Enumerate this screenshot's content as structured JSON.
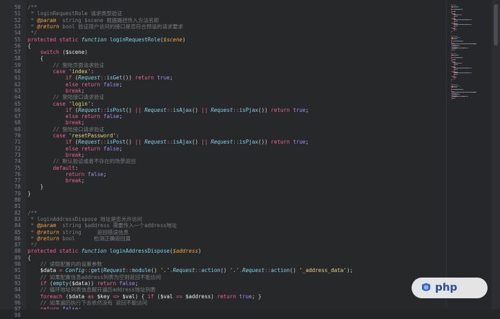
{
  "editor": {
    "first_line": 50,
    "lines": [
      [
        [
          "c",
          "/**"
        ]
      ],
      [
        [
          "c",
          " * loginRequestRole 请求类型验证"
        ]
      ],
      [
        [
          "c",
          " * "
        ],
        [
          "d",
          "@param"
        ],
        [
          "c",
          "  string $scene 根据路径传入方法名称"
        ]
      ],
      [
        [
          "c",
          " * "
        ],
        [
          "d",
          "@return"
        ],
        [
          "c",
          " bool 验证用户访问的接口是否符合预设的请求要求"
        ]
      ],
      [
        [
          "c",
          " */"
        ]
      ],
      [
        [
          "k",
          "protected static "
        ],
        [
          "i",
          "function "
        ],
        [
          "f",
          "loginRequestRole"
        ],
        [
          "p",
          "("
        ],
        [
          "d",
          "$scene"
        ],
        [
          "p",
          ")"
        ]
      ],
      [
        [
          "p",
          "{"
        ]
      ],
      [
        [
          "p",
          "    "
        ],
        [
          "k",
          "switch "
        ],
        [
          "p",
          "("
        ],
        [
          "v",
          "$scene"
        ],
        [
          "p",
          ")"
        ]
      ],
      [
        [
          "p",
          "    {"
        ]
      ],
      [
        [
          "c",
          "        // 登陆页面请求验证"
        ]
      ],
      [
        [
          "p",
          "        "
        ],
        [
          "k",
          "case "
        ],
        [
          "s",
          "'index'"
        ],
        [
          "p",
          ":"
        ]
      ],
      [
        [
          "p",
          "            "
        ],
        [
          "k",
          "if "
        ],
        [
          "p",
          "("
        ],
        [
          "i",
          "Request"
        ],
        [
          "k",
          "::"
        ],
        [
          "f",
          "isGet"
        ],
        [
          "p",
          "()) "
        ],
        [
          "k",
          "return "
        ],
        [
          "n",
          "true"
        ],
        [
          "p",
          ";"
        ]
      ],
      [
        [
          "p",
          "            "
        ],
        [
          "k",
          "else return "
        ],
        [
          "n",
          "false"
        ],
        [
          "p",
          ";"
        ]
      ],
      [
        [
          "p",
          "            "
        ],
        [
          "k",
          "break"
        ],
        [
          "p",
          ";"
        ]
      ],
      [
        [
          "c",
          "        // 登陆接口请求验证"
        ]
      ],
      [
        [
          "p",
          "        "
        ],
        [
          "k",
          "case "
        ],
        [
          "s",
          "'login'"
        ],
        [
          "p",
          ":"
        ]
      ],
      [
        [
          "p",
          "            "
        ],
        [
          "k",
          "if "
        ],
        [
          "p",
          "("
        ],
        [
          "i",
          "Request"
        ],
        [
          "k",
          "::"
        ],
        [
          "f",
          "isPost"
        ],
        [
          "p",
          "() "
        ],
        [
          "k",
          "|| "
        ],
        [
          "i",
          "Request"
        ],
        [
          "k",
          "::"
        ],
        [
          "f",
          "isAjax"
        ],
        [
          "p",
          "() "
        ],
        [
          "k",
          "|| "
        ],
        [
          "i",
          "Request"
        ],
        [
          "k",
          "::"
        ],
        [
          "f",
          "isPjax"
        ],
        [
          "p",
          "()) "
        ],
        [
          "k",
          "return "
        ],
        [
          "n",
          "true"
        ],
        [
          "p",
          ";"
        ]
      ],
      [
        [
          "p",
          "            "
        ],
        [
          "k",
          "else return "
        ],
        [
          "n",
          "false"
        ],
        [
          "p",
          ";"
        ]
      ],
      [
        [
          "p",
          "            "
        ],
        [
          "k",
          "break"
        ],
        [
          "p",
          ";"
        ]
      ],
      [
        [
          "c",
          "        // 登陆接口请求验证"
        ]
      ],
      [
        [
          "p",
          "        "
        ],
        [
          "k",
          "case "
        ],
        [
          "s",
          "'resetPassword'"
        ],
        [
          "p",
          ":"
        ]
      ],
      [
        [
          "p",
          "            "
        ],
        [
          "k",
          "if "
        ],
        [
          "p",
          "("
        ],
        [
          "i",
          "Request"
        ],
        [
          "k",
          "::"
        ],
        [
          "f",
          "isPost"
        ],
        [
          "p",
          "() "
        ],
        [
          "k",
          "|| "
        ],
        [
          "i",
          "Request"
        ],
        [
          "k",
          "::"
        ],
        [
          "f",
          "isAjax"
        ],
        [
          "p",
          "() "
        ],
        [
          "k",
          "|| "
        ],
        [
          "i",
          "Request"
        ],
        [
          "k",
          "::"
        ],
        [
          "f",
          "isPjax"
        ],
        [
          "p",
          "()) "
        ],
        [
          "k",
          "return "
        ],
        [
          "n",
          "true"
        ],
        [
          "p",
          ";"
        ]
      ],
      [
        [
          "p",
          "            "
        ],
        [
          "k",
          "else return "
        ],
        [
          "n",
          "false"
        ],
        [
          "p",
          ";"
        ]
      ],
      [
        [
          "p",
          "            "
        ],
        [
          "k",
          "break"
        ],
        [
          "p",
          ";"
        ]
      ],
      [
        [
          "c",
          "        // 默认验证或者不存在的场景返回"
        ]
      ],
      [
        [
          "p",
          "        "
        ],
        [
          "k",
          "default"
        ],
        [
          "p",
          ":"
        ]
      ],
      [
        [
          "p",
          "            "
        ],
        [
          "k",
          "return "
        ],
        [
          "n",
          "false"
        ],
        [
          "p",
          ";"
        ]
      ],
      [
        [
          "p",
          "            "
        ],
        [
          "k",
          "break"
        ],
        [
          "p",
          ";"
        ]
      ],
      [
        [
          "p",
          "    }"
        ]
      ],
      [
        [
          "p",
          "}"
        ]
      ],
      [],
      [],
      [
        [
          "c",
          "/**"
        ]
      ],
      [
        [
          "c",
          " * loginAddressDispose 地址是否允许访问"
        ]
      ],
      [
        [
          "c",
          " * "
        ],
        [
          "d",
          "@param"
        ],
        [
          "c",
          "  string $address 需要传入一个address地址"
        ]
      ],
      [
        [
          "c",
          " * "
        ],
        [
          "d",
          "@return"
        ],
        [
          "c",
          " string     返回错误信息"
        ]
      ],
      [
        [
          "c",
          " * "
        ],
        [
          "d",
          "@return"
        ],
        [
          "c",
          " bool      检测正确返回真"
        ]
      ],
      [
        [
          "c",
          " */"
        ]
      ],
      [
        [
          "k",
          "protected static "
        ],
        [
          "i",
          "function "
        ],
        [
          "f",
          "loginAddressDispose"
        ],
        [
          "p",
          "("
        ],
        [
          "d",
          "$address"
        ],
        [
          "p",
          ")"
        ]
      ],
      [
        [
          "p",
          "{"
        ]
      ],
      [
        [
          "c",
          "    // 读取配置内的设置参数"
        ]
      ],
      [
        [
          "p",
          "    "
        ],
        [
          "v",
          "$data "
        ],
        [
          "k",
          "= "
        ],
        [
          "i",
          "Config"
        ],
        [
          "k",
          "::"
        ],
        [
          "f",
          "get"
        ],
        [
          "p",
          "("
        ],
        [
          "i",
          "Request"
        ],
        [
          "k",
          "::"
        ],
        [
          "f",
          "module"
        ],
        [
          "p",
          "() "
        ],
        [
          "s",
          "'.'"
        ],
        [
          "k",
          "."
        ],
        [
          "i",
          "Request"
        ],
        [
          "k",
          "::"
        ],
        [
          "f",
          "action"
        ],
        [
          "p",
          "() "
        ],
        [
          "s",
          "'.'"
        ],
        [
          "k",
          "."
        ],
        [
          "i",
          "Request"
        ],
        [
          "k",
          "::"
        ],
        [
          "f",
          "action"
        ],
        [
          "p",
          "() "
        ],
        [
          "s",
          "'_address_data'"
        ],
        [
          "p",
          ");"
        ]
      ],
      [
        [
          "c",
          "    // 如果配置信息address列表为空则返回不能访问"
        ]
      ],
      [
        [
          "p",
          "    "
        ],
        [
          "k",
          "if "
        ],
        [
          "p",
          "("
        ],
        [
          "f",
          "empty"
        ],
        [
          "p",
          "("
        ],
        [
          "v",
          "$data"
        ],
        [
          "p",
          ")) "
        ],
        [
          "k",
          "return "
        ],
        [
          "n",
          "false"
        ],
        [
          "p",
          ";"
        ]
      ],
      [
        [
          "c",
          "    // 循环地址列表信息解开遍历address地址列表"
        ]
      ],
      [
        [
          "p",
          "    "
        ],
        [
          "k",
          "foreach "
        ],
        [
          "p",
          "("
        ],
        [
          "v",
          "$data "
        ],
        [
          "k",
          "as "
        ],
        [
          "v",
          "$key "
        ],
        [
          "k",
          "=> "
        ],
        [
          "v",
          "$val"
        ],
        [
          "p",
          ") { "
        ],
        [
          "k",
          "if "
        ],
        [
          "p",
          "("
        ],
        [
          "v",
          "$val "
        ],
        [
          "k",
          "== "
        ],
        [
          "v",
          "$address"
        ],
        [
          "p",
          ") "
        ],
        [
          "k",
          "return "
        ],
        [
          "n",
          "true"
        ],
        [
          "p",
          "; }"
        ]
      ],
      [
        [
          "c",
          "    // 如果遍历执行下去依然没有 返回不能访问"
        ]
      ],
      [
        [
          "p",
          "    "
        ],
        [
          "k",
          "return "
        ],
        [
          "n",
          "false"
        ],
        [
          "p",
          ";"
        ]
      ],
      [
        [
          "p",
          "}"
        ]
      ]
    ]
  },
  "watermark": {
    "text": "php"
  },
  "colors": {
    "background": "#262829",
    "keyword": "#f2618f",
    "function": "#7fd6e8",
    "string": "#e6db74",
    "comment": "#7a7d80",
    "constant": "#a989f5"
  }
}
